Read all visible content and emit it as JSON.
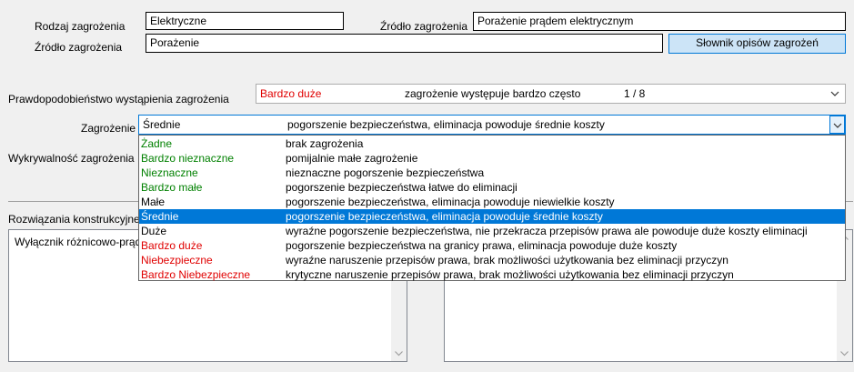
{
  "top": {
    "rodzaj_label": "Rodzaj zagrożenia",
    "rodzaj_value": "Elektryczne",
    "zrodlo_right_label": "Źródło zagrożenia",
    "zrodlo_right_value": "Porażenie prądem elektrycznym",
    "zrodlo_left_label": "Źródło zagrożenia",
    "zrodlo_left_value": "Porażenie",
    "slownik_button": "Słownik opisów zagrożeń"
  },
  "probability": {
    "label": "Prawdopodobieństwo wystąpienia zagrożenia",
    "level": "Bardzo duże",
    "level_color": "#e00000",
    "description": "zagrożenie występuje bardzo często",
    "fraction": "1 / 8"
  },
  "hazard": {
    "label": "Zagrożenie",
    "level": "Średnie",
    "description": "pogorszenie bezpieczeństwa, eliminacja powoduje średnie koszty"
  },
  "detectability": {
    "label": "Wykrywalność zagrożenia"
  },
  "solutions": {
    "label": "Rozwiązania konstrukcyjne",
    "text": "Wyłącznik różnicowo-prądowy"
  },
  "options": [
    {
      "level": "Żadne",
      "description": "brak zagrożenia",
      "color": "#008000"
    },
    {
      "level": "Bardzo nieznaczne",
      "description": "pomijalnie małe zagrożenie",
      "color": "#008000"
    },
    {
      "level": "Nieznaczne",
      "description": "nieznaczne pogorszenie bezpieczeństwa",
      "color": "#008000"
    },
    {
      "level": "Bardzo małe",
      "description": "pogorszenie bezpieczeństwa łatwe do eliminacji",
      "color": "#008000"
    },
    {
      "level": "Małe",
      "description": "pogorszenie bezpieczeństwa, eliminacja powoduje niewielkie koszty",
      "color": "#000000"
    },
    {
      "level": "Średnie",
      "description": "pogorszenie bezpieczeństwa, eliminacja powoduje średnie koszty",
      "color": "#000000",
      "selected": true
    },
    {
      "level": "Duże",
      "description": "wyraźne pogorszenie bezpieczeństwa, nie przekracza przepisów prawa ale powoduje duże koszty eliminacji",
      "color": "#000000"
    },
    {
      "level": "Bardzo duże",
      "description": "pogorszenie bezpieczeństwa na granicy prawa, eliminacja powoduje duże koszty",
      "color": "#e00000"
    },
    {
      "level": "Niebezpieczne",
      "description": "wyraźne naruszenie przepisów prawa, brak możliwości użytkowania bez eliminacji przyczyn",
      "color": "#e00000"
    },
    {
      "level": "Bardzo Niebezpieczne",
      "description": "krytyczne naruszenie przepisów prawa, brak możliwości użytkowania bez eliminacji przyczyn",
      "color": "#e00000"
    }
  ],
  "icons": {
    "combo_arrow": "chevron-down-icon",
    "scroll_up": "scroll-up-arrow-icon",
    "scroll_down": "scroll-down-arrow-icon"
  }
}
